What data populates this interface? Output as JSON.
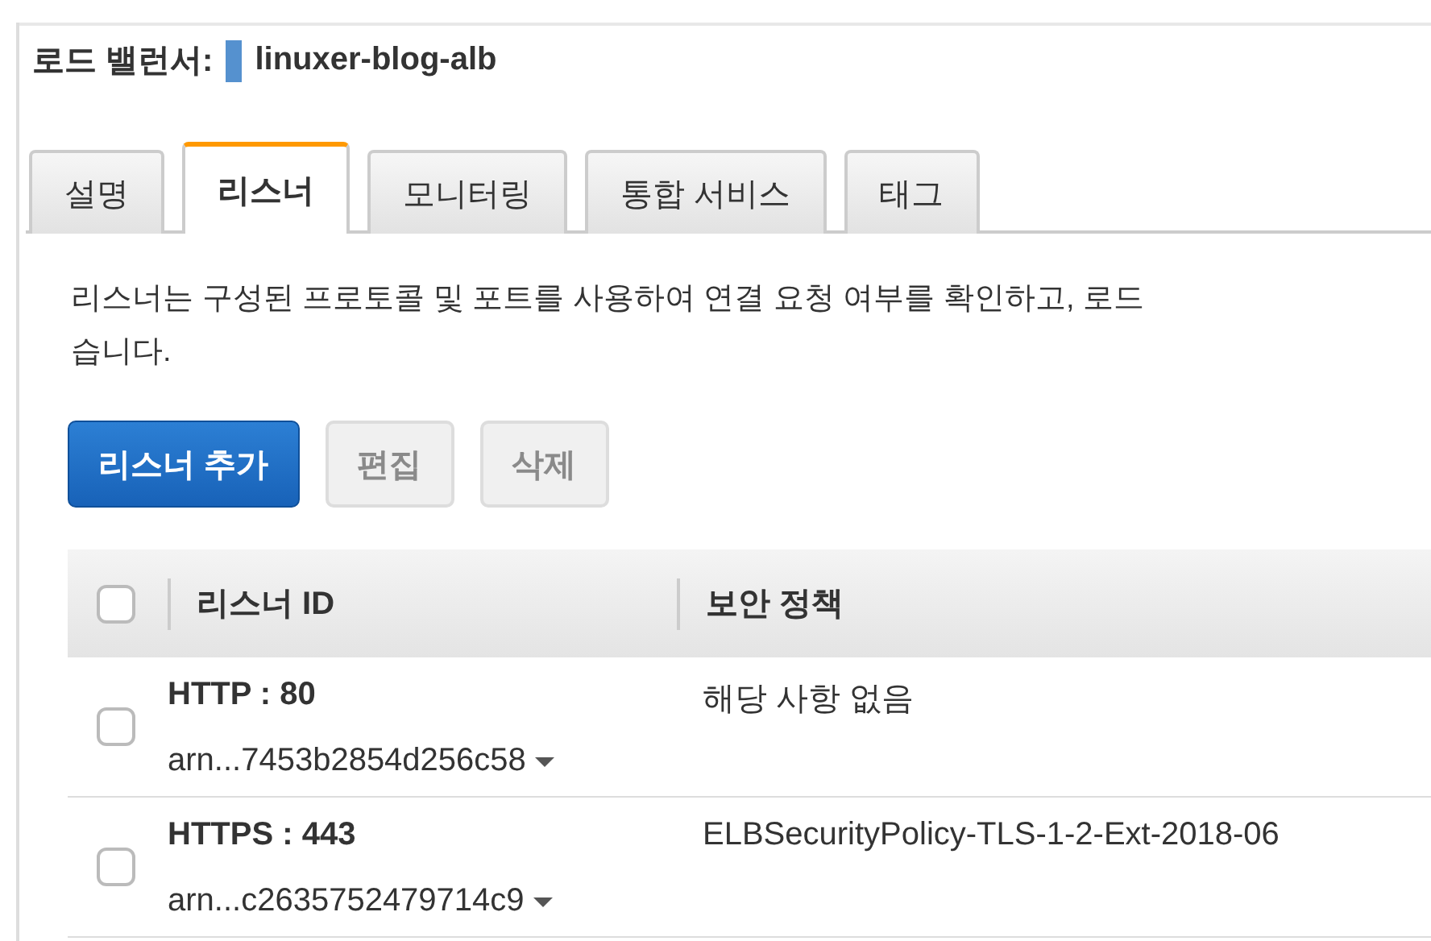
{
  "header": {
    "label": "로드 밸런서:",
    "name": "linuxer-blog-alb"
  },
  "tabs": [
    {
      "label": "설명",
      "selected": false
    },
    {
      "label": "리스너",
      "selected": true
    },
    {
      "label": "모니터링",
      "selected": false
    },
    {
      "label": "통합 서비스",
      "selected": false
    },
    {
      "label": "태그",
      "selected": false
    }
  ],
  "description": [
    "리스너는 구성된 프로토콜 및 포트를 사용하여 연결 요청 여부를 확인하고, 로드",
    "습니다."
  ],
  "buttons": [
    {
      "label": "리스너 추가",
      "kind": "primary",
      "disabled": false
    },
    {
      "label": "편집",
      "kind": "secondary",
      "disabled": true
    },
    {
      "label": "삭제",
      "kind": "secondary",
      "disabled": true
    }
  ],
  "table": {
    "select_all": {
      "checked": false
    },
    "columns": [
      "리스너 ID",
      "보안 정책"
    ],
    "rows": [
      {
        "checked": false,
        "listener": "HTTP : 80",
        "arn": "arn...7453b2854d256c58",
        "policy": "해당 사항 없음"
      },
      {
        "checked": false,
        "listener": "HTTPS : 443",
        "arn": "arn...c2635752479714c9",
        "policy": "ELBSecurityPolicy-TLS-1-2-Ext-2018-06"
      }
    ]
  }
}
